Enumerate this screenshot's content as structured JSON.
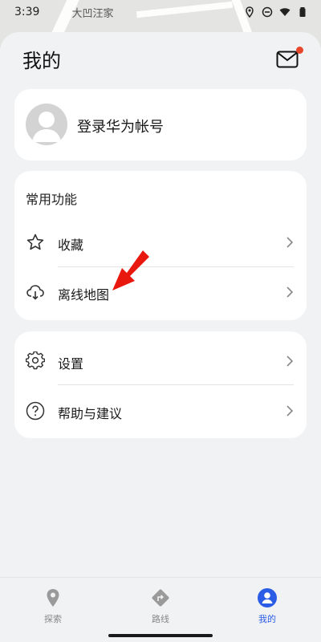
{
  "status_bar": {
    "time": "3:39",
    "map_label": "大凹汪家"
  },
  "header": {
    "title": "我的"
  },
  "account": {
    "login_label": "登录华为帐号"
  },
  "features": {
    "section_title": "常用功能",
    "items": [
      {
        "label": "收藏",
        "icon": "star-icon"
      },
      {
        "label": "离线地图",
        "icon": "cloud-download-icon"
      }
    ]
  },
  "settings": {
    "items": [
      {
        "label": "设置",
        "icon": "gear-icon"
      },
      {
        "label": "帮助与建议",
        "icon": "help-circle-icon"
      }
    ]
  },
  "tabbar": {
    "tabs": [
      {
        "label": "探索",
        "icon": "location-pin-icon",
        "active": false
      },
      {
        "label": "路线",
        "icon": "route-turn-icon",
        "active": false
      },
      {
        "label": "我的",
        "icon": "person-icon",
        "active": true
      }
    ]
  },
  "colors": {
    "accent": "#2b5ce6",
    "notification_dot": "#e8462a",
    "annotation_arrow": "#e8180f",
    "background": "#f1f2f4",
    "card": "#ffffff"
  }
}
